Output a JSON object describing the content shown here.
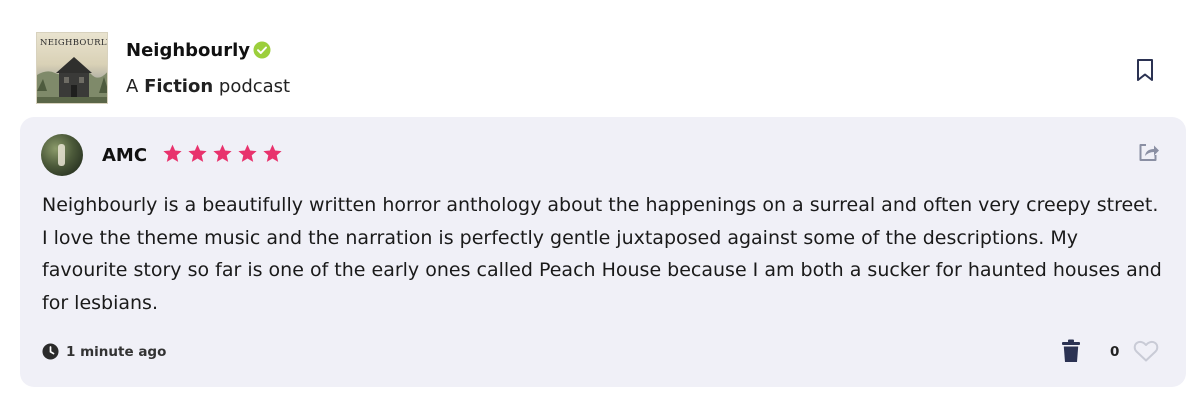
{
  "podcast": {
    "cover_title": "NEIGHBOURLY",
    "name": "Neighbourly",
    "prefix": "A",
    "genre": "Fiction",
    "suffix": "podcast"
  },
  "review": {
    "reviewer": "AMC",
    "rating": 5,
    "text": "Neighbourly is a beautifully written horror anthology about the happenings on a surreal and often very creepy street. I love the theme music and the narration is perfectly gentle juxtaposed against some of the descriptions. My favourite story so far is one of the early ones called Peach House because I am both a sucker for haunted houses and for lesbians.",
    "timestamp": "1 minute ago",
    "like_count": "0"
  },
  "colors": {
    "star": "#e8336d",
    "verified": "#9ccf3c",
    "card_background": "#f0f0f7",
    "icon_navy": "#2b3252",
    "icon_muted": "#8a8fa3"
  },
  "icons": [
    "verified-icon",
    "bookmark-icon",
    "star-icon",
    "share-icon",
    "clock-icon",
    "trash-icon",
    "heart-icon"
  ]
}
